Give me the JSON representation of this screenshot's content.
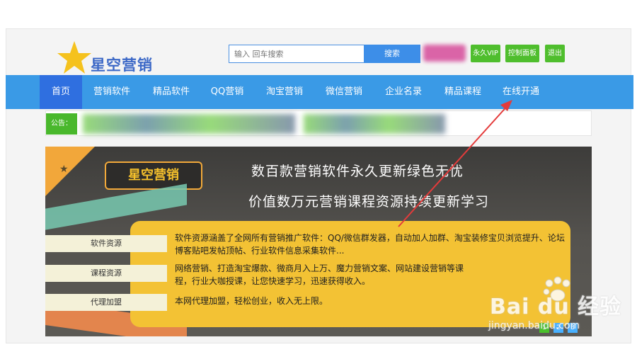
{
  "header": {
    "logo_text": "星空营销",
    "search_placeholder": "输入 回车搜索",
    "search_button": "搜索",
    "buttons": [
      "永久VIP",
      "控制面板",
      "退出"
    ]
  },
  "nav": {
    "items": [
      "首页",
      "营销软件",
      "精品软件",
      "QQ营销",
      "淘宝营销",
      "微信营销",
      "企业名录",
      "精品课程",
      "在线开通"
    ],
    "active_index": 0
  },
  "notice": {
    "label": "公告："
  },
  "banner": {
    "brand": "星空营销",
    "headline1": "数百款营销软件永久更新绿色无忧",
    "headline2": "价值数万元营销课程资源持续更新学习",
    "tabs": [
      "软件资源",
      "课程资源",
      "代理加盟"
    ],
    "descriptions": [
      "软件资源涵盖了全网所有营销推广软件：QQ/微信群发器，自动加人加群、淘宝装修宝贝浏览提升、论坛博客贴吧发帖顶帖、行业软件信息采集软件...",
      "网络营销、打造淘宝爆款、微商月入上万、魔力营销文案、网站建设营销等课程，行业大咖授课，让您快速学习，迅速获得收入。",
      "本网代理加盟，轻松创业，收入无上限。"
    ],
    "slides": [
      "1",
      "2",
      "3"
    ],
    "active_slide": 0
  },
  "watermark": {
    "brand": "Bai du 经验",
    "url": "jingyan.baidu.com"
  },
  "colors": {
    "nav_bg": "#3a9ae6",
    "nav_active": "#2f6fe0",
    "green_button": "#4fbe2d",
    "panel_yellow": "#f3c234",
    "annotation_red": "#e43b3b"
  }
}
